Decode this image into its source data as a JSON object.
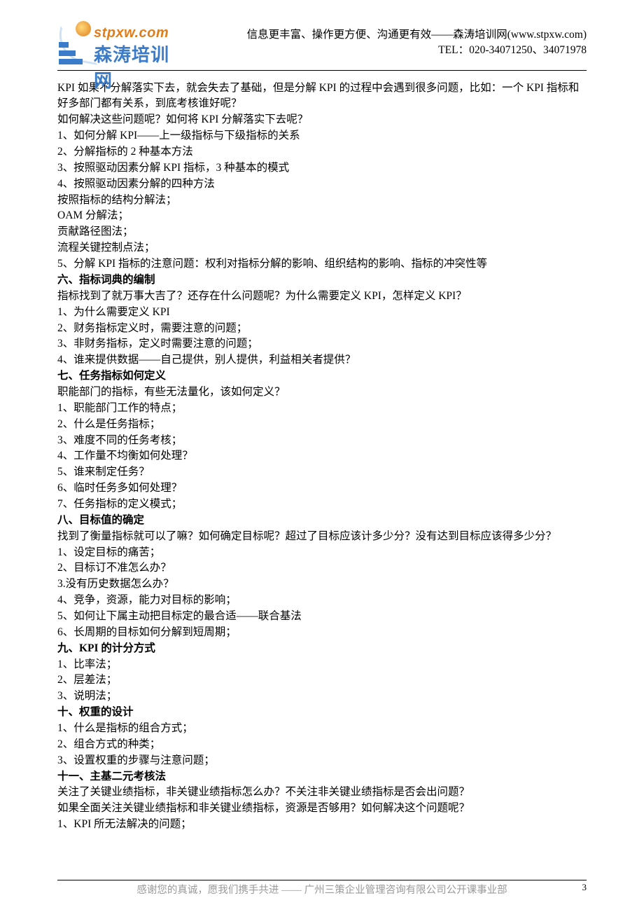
{
  "header": {
    "logo_url": "stpxw.com",
    "logo_cn": "森涛培训网",
    "tagline": "信息更丰富、操作更方便、沟通更有效——森涛培训网(www.stpxw.com)",
    "tel": "TEL：020-34071250、34071978"
  },
  "body": {
    "intro": [
      "KPI 如果不分解落实下去，就会失去了基础，但是分解 KPI 的过程中会遇到很多问题，比如：一个 KPI 指标和好多部门都有关系，到底考核谁好呢？",
      "如何解决这些问题呢？如何将 KPI 分解落实下去呢？",
      "1、如何分解 KPI——上一级指标与下级指标的关系",
      "2、分解指标的 2 种基本方法",
      "3、按照驱动因素分解 KPI 指标，3 种基本的模式",
      "4、按照驱动因素分解的四种方法",
      "按照指标的结构分解法；",
      "OAM 分解法；",
      "贡献路径图法；",
      "流程关键控制点法；",
      "5、分解 KPI 指标的注意问题：权利对指标分解的影响、组织结构的影响、指标的冲突性等"
    ],
    "s6": {
      "title": "六、指标词典的编制",
      "lines": [
        "指标找到了就万事大吉了？还存在什么问题呢？为什么需要定义 KPI，怎样定义 KPI？",
        "1、为什么需要定义 KPI",
        "2、财务指标定义时，需要注意的问题；",
        "3、非财务指标，定义时需要注意的问题；",
        "4、谁来提供数据——自己提供，别人提供，利益相关者提供？"
      ]
    },
    "s7": {
      "title": "七、任务指标如何定义",
      "lines": [
        "职能部门的指标，有些无法量化，该如何定义？",
        "1、职能部门工作的特点；",
        "2、什么是任务指标；",
        "3、难度不同的任务考核；",
        "4、工作量不均衡如何处理？",
        "5、谁来制定任务？",
        "6、临时任务多如何处理？",
        "7、任务指标的定义模式；"
      ]
    },
    "s8": {
      "title": "八、目标值的确定",
      "lines": [
        "找到了衡量指标就可以了嘛？如何确定目标呢？超过了目标应该计多少分？没有达到目标应该得多少分？",
        "1、设定目标的痛苦；",
        "2、目标订不准怎么办？",
        "3.没有历史数据怎么办？",
        "4、竞争，资源，能力对目标的影响；",
        "5、如何让下属主动把目标定的最合适——联合基法",
        "6、长周期的目标如何分解到短周期；"
      ]
    },
    "s9": {
      "title": "九、KPI 的计分方式",
      "lines": [
        "1、比率法；",
        "2、层差法；",
        "3、说明法；"
      ]
    },
    "s10": {
      "title": "十、权重的设计",
      "lines": [
        "1、什么是指标的组合方式；",
        "2、组合方式的种类；",
        "3、设置权重的步骤与注意问题；"
      ]
    },
    "s11": {
      "title": "十一、主基二元考核法",
      "lines": [
        "关注了关键业绩指标，非关键业绩指标怎么办？不关注非关键业绩指标是否会出问题？",
        "如果全面关注关键业绩指标和非关键业绩指标，资源是否够用？如何解决这个问题呢？",
        "1、KPI 所无法解决的问题；"
      ]
    }
  },
  "footer": {
    "text": "感谢您的真诚，愿我们携手共进 —— 广州三策企业管理咨询有限公司公开课事业部",
    "page": "3"
  }
}
